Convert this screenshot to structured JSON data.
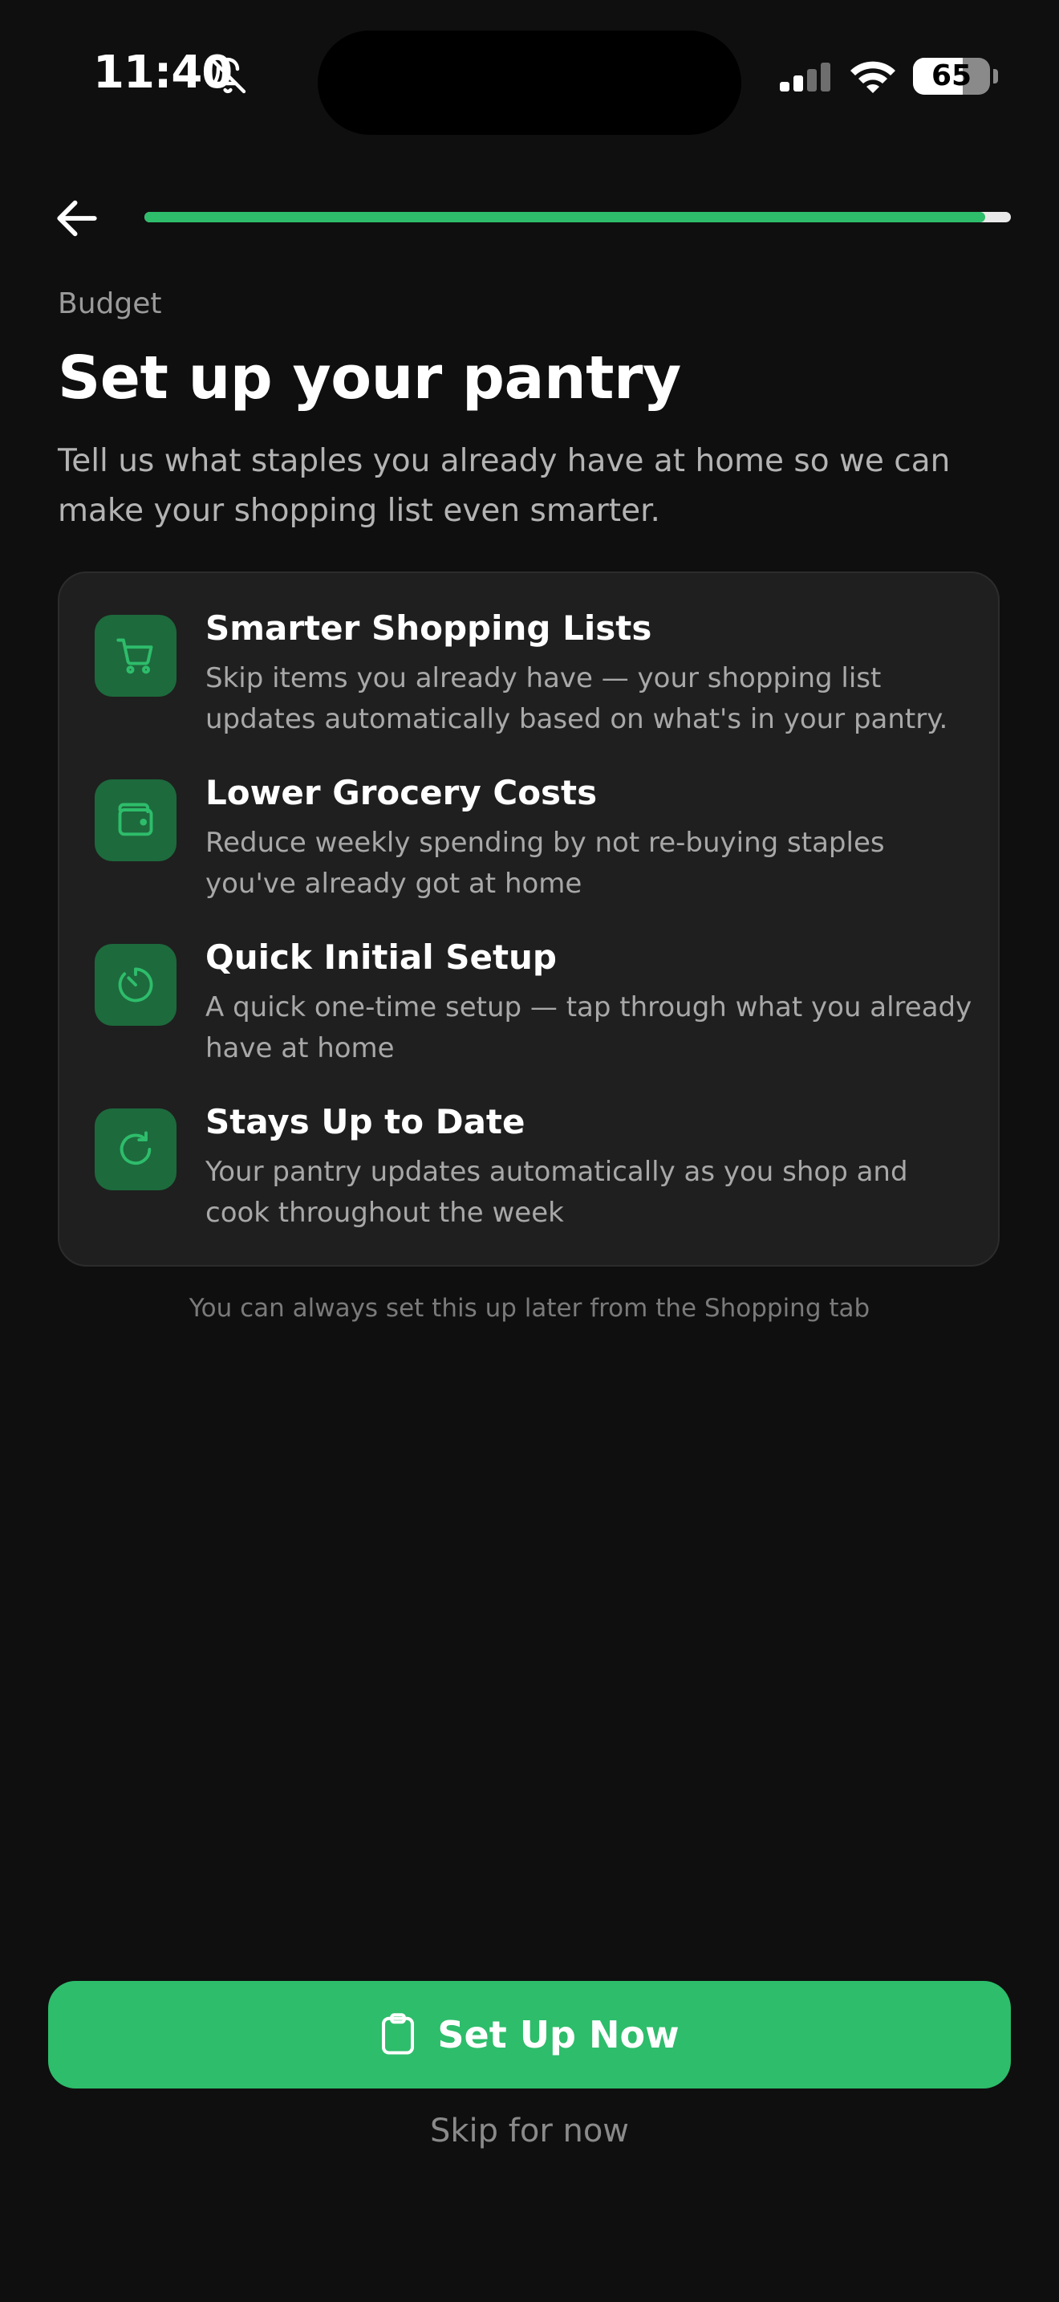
{
  "status_bar": {
    "time": "11:40",
    "battery_level": "65",
    "battery_fraction": 0.65,
    "icons": [
      "bell-slash-icon",
      "signal-icon",
      "wifi-icon",
      "battery-icon"
    ]
  },
  "header": {
    "back_icon": "arrow-left-icon",
    "progress_fraction": 0.97,
    "progress_color": "#2ebd6b"
  },
  "page": {
    "eyebrow": "Budget",
    "title": "Set up your pantry",
    "subtitle": "Tell us what staples you already have at home so we can make your shopping list even smarter."
  },
  "benefits": [
    {
      "icon": "cart-icon",
      "title": "Smarter Shopping Lists",
      "description": "Skip items you already have — your shopping list updates automatically based on what's in your pantry."
    },
    {
      "icon": "wallet-icon",
      "title": "Lower Grocery Costs",
      "description": "Reduce weekly spending by not re-buying staples you've already got at home"
    },
    {
      "icon": "timer-icon",
      "title": "Quick Initial Setup",
      "description": "A quick one-time setup — tap through what you already have at home"
    },
    {
      "icon": "refresh-icon",
      "title": "Stays Up to Date",
      "description": "Your pantry updates automatically as you shop and cook throughout the week"
    }
  ],
  "footnote": "You can always set this up later from the Shopping tab",
  "actions": {
    "primary_label": "Set Up Now",
    "primary_icon": "clipboard-icon",
    "secondary_label": "Skip for now"
  },
  "colors": {
    "accent": "#2ebd6b",
    "icon_tile": "#1d6a3d",
    "background": "#0f0f0f",
    "card": "#1f1f1f"
  }
}
